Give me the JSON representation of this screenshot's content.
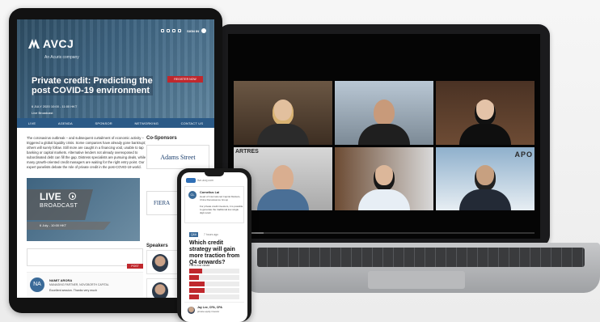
{
  "tablet": {
    "brand": "AVCJ",
    "brand_sub": "An Acuris company",
    "signin": "SIGN IN",
    "event_title": "Private credit: Predicting the post COVID-19 environment",
    "event_date": "6 JULY 2020 10:00 - 11:00 HKT",
    "event_format": "Live Broadcast",
    "register_label": "REGISTER NOW",
    "tabs": [
      "LIVE",
      "AGENDA",
      "SPONSOR",
      "NETWORKING",
      "CONTACT US"
    ],
    "article": "The coronavirus outbreak – and subsequent curtailment of economic activity – triggered a global liquidity crisis. Some companies have already gone bankrupt; others will surely follow. Still more are caught in a financing void, unable to tap banking or capital markets. Alternative lenders not already overexposed to subordinated debt can fill the gap. Distress specialists are pursuing deals, while many growth-oriented credit managers are waiting for the right entry point. Our expert panelists debate the role of private credit in the post-COVID-19 world.",
    "live_label": "LIVE",
    "broadcast_label": "BROADCAST",
    "live_when": "6 July - 10:00 HKT",
    "post_label": "POST",
    "cosponsors_title": "Co-Sponsors",
    "sponsors": [
      "Adams Street",
      "FIERA"
    ],
    "speakers_title": "Speakers",
    "comment": {
      "initials": "NA",
      "name": "NAMIT ARORA",
      "role": "MANAGING PARTNER, NOVOBORTH CAPITAL",
      "text": "Excellent session. Thanks very much"
    }
  },
  "laptop": {
    "labels": [
      "ARTRES",
      "APO"
    ],
    "progress": 0.1
  },
  "phone": {
    "url": "live.avcj.com",
    "card": {
      "initials": "CL",
      "name": "Cornelius Lai",
      "role": "Head of International Capital Markets, China Renaissance Group",
      "text": "For private credit investors, it is possible to generate the traditional low single digit return"
    },
    "tag": "Q&A",
    "ago": "7 hours ago",
    "question": "Which credit strategy will gain more traction from Q4 onwards?",
    "poll_label": "Poll is now closed",
    "poll": [
      {
        "label": "",
        "value": 0.25
      },
      {
        "label": "",
        "value": 0.2
      },
      {
        "label": "",
        "value": 0.3
      },
      {
        "label": "",
        "value": 0.3
      },
      {
        "label": "",
        "value": 0.2
      }
    ],
    "comment": {
      "name": "Jay Lee, CFA, CPA",
      "role": "private equity investor"
    }
  },
  "colors": {
    "accent_red": "#c0282d",
    "nav_blue": "#2b5a87"
  }
}
